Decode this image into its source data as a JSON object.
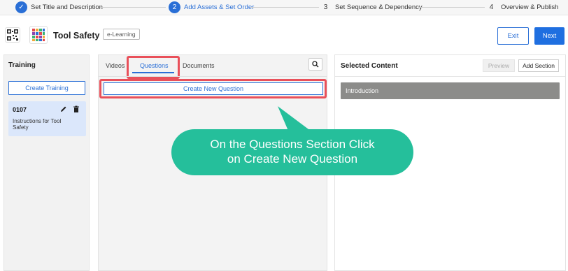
{
  "stepper": {
    "steps": [
      {
        "number": "✓",
        "label": "Set Title and Description",
        "state": "done"
      },
      {
        "number": "2",
        "label": "Add Assets & Set Order",
        "state": "active"
      },
      {
        "number": "3",
        "label": "Set Sequence & Dependency",
        "state": "todo"
      },
      {
        "number": "4",
        "label": "Overview & Publish",
        "state": "todo"
      }
    ]
  },
  "header": {
    "title": "Tool Safety",
    "tag": "e-Learning",
    "exit_label": "Exit",
    "next_label": "Next",
    "icons": [
      "qr-code-icon",
      "app-grid-icon"
    ]
  },
  "training_panel": {
    "heading": "Training",
    "create_button": "Create Training",
    "card": {
      "id": "0107",
      "description": "Instructions for Tool Safety"
    }
  },
  "assets_panel": {
    "tabs": [
      {
        "label": "Videos",
        "active": false
      },
      {
        "label": "Questions",
        "active": true
      },
      {
        "label": "Documents",
        "active": false
      }
    ],
    "create_button": "Create New Question"
  },
  "selected_panel": {
    "heading": "Selected Content",
    "preview_label": "Preview",
    "add_section_label": "Add Section",
    "sections": [
      "Introduction"
    ]
  },
  "callout": {
    "line1": "On the Questions Section Click",
    "line2": "on Create New Question"
  },
  "colors": {
    "accent": "#2a6fd6",
    "highlight": "#e9505a",
    "callout": "#25bf9b",
    "section_bar": "#8c8c8a"
  }
}
